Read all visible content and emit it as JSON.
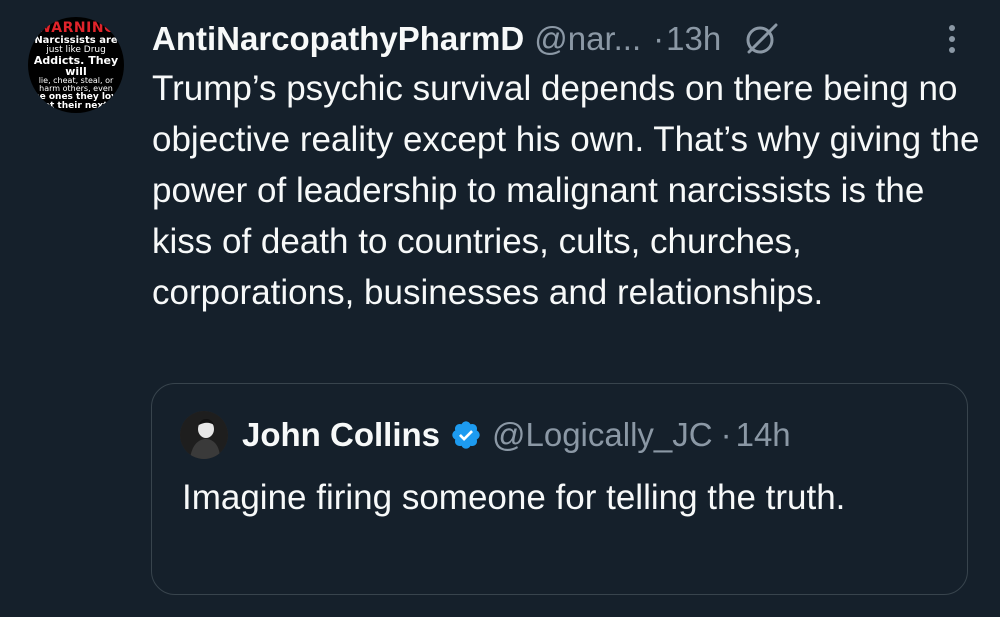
{
  "tweet": {
    "author": {
      "display_name": "AntiNarcopathyPharmD",
      "handle": "@nar...",
      "avatar_text": {
        "line1": "WARNING",
        "line2": "Narcissists are",
        "line3": "just like Drug",
        "line4": "Addicts. They will",
        "line5": "lie, cheat, steal, or",
        "line6": "harm others, even",
        "line7": "the ones they love",
        "line8": "get their next f"
      }
    },
    "separator": "·",
    "time": "13h",
    "grok_icon": "grok-icon",
    "more_icon": "more-icon",
    "text": "Trump’s psychic survival depends on there being no objective reality except his own. That’s why giving the power of leadership to malignant narcissists is the kiss of death to countries, cults, churches, corporations, businesses and relationships."
  },
  "quote": {
    "author": {
      "display_name": "John Collins",
      "handle": "@Logically_JC",
      "verified_icon": "verified-badge-icon"
    },
    "separator": "·",
    "time": "14h",
    "text": "Imagine firing someone for telling the truth."
  },
  "colors": {
    "background": "#15202b",
    "primary_text": "#f7f9f9",
    "secondary_text": "#8b98a5",
    "border": "#38444d",
    "verified_blue": "#1d9bf0",
    "avatar_warning_red": "#e0242b"
  }
}
